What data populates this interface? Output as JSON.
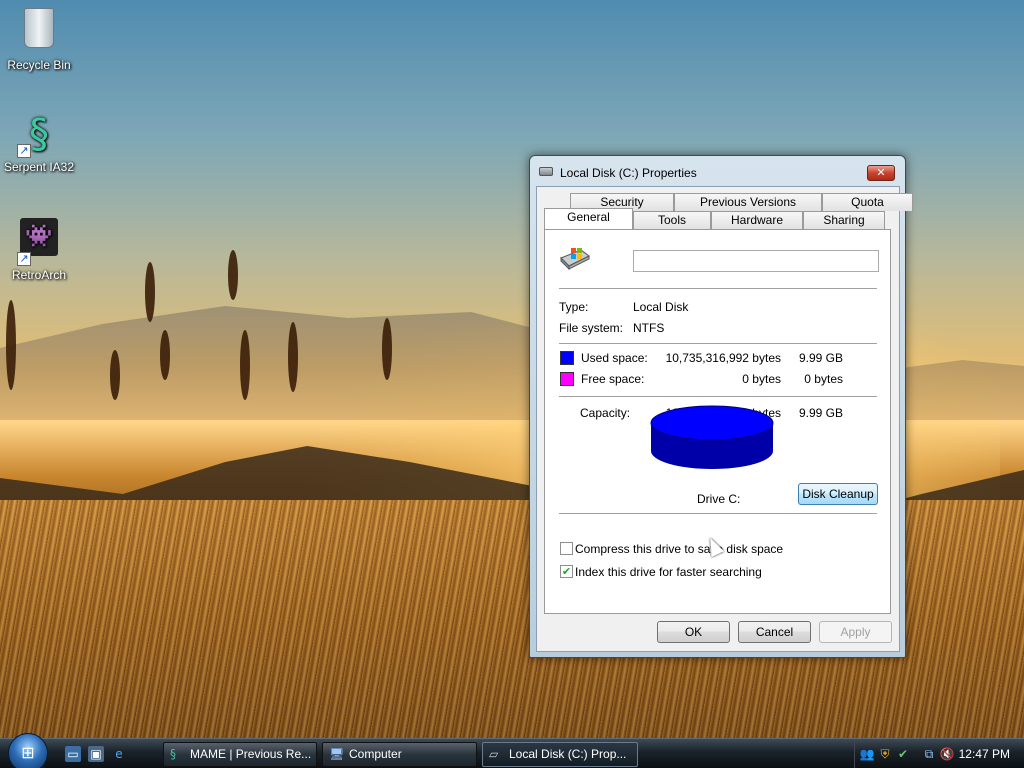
{
  "desktop": {
    "icons": [
      {
        "label": "Recycle Bin",
        "icon": "recycle-bin-icon"
      },
      {
        "label": "Serpent IA32",
        "icon": "serpent-icon"
      },
      {
        "label": "RetroArch",
        "icon": "retroarch-icon"
      }
    ]
  },
  "dialog": {
    "title": "Local Disk (C:) Properties",
    "close_label": "✕",
    "tabs_top": [
      "Security",
      "Previous Versions",
      "Quota"
    ],
    "tabs_bottom": [
      "General",
      "Tools",
      "Hardware",
      "Sharing"
    ],
    "active_tab": "General",
    "name_value": "",
    "type_label": "Type:",
    "type_value": "Local Disk",
    "fs_label": "File system:",
    "fs_value": "NTFS",
    "used": {
      "label": "Used space:",
      "bytes": "10,735,316,992 bytes",
      "size": "9.99 GB",
      "color": "#0000ff"
    },
    "free": {
      "label": "Free space:",
      "bytes": "0 bytes",
      "size": "0 bytes",
      "color": "#ff00ff"
    },
    "capacity": {
      "label": "Capacity:",
      "bytes": "10,735,316,992 bytes",
      "size": "9.99 GB"
    },
    "drive_label": "Drive C:",
    "cleanup_label": "Disk Cleanup",
    "compress_label": "Compress this drive to save disk space",
    "compress_checked": false,
    "index_label": "Index this drive for faster searching",
    "index_checked": true,
    "ok_label": "OK",
    "cancel_label": "Cancel",
    "apply_label": "Apply"
  },
  "taskbar": {
    "tasks": [
      {
        "label": "MAME | Previous Re...",
        "icon": "serpent-icon"
      },
      {
        "label": "Computer",
        "icon": "computer-icon"
      },
      {
        "label": "Local Disk (C:) Prop...",
        "icon": "drive-icon"
      }
    ],
    "clock": "12:47 PM"
  }
}
